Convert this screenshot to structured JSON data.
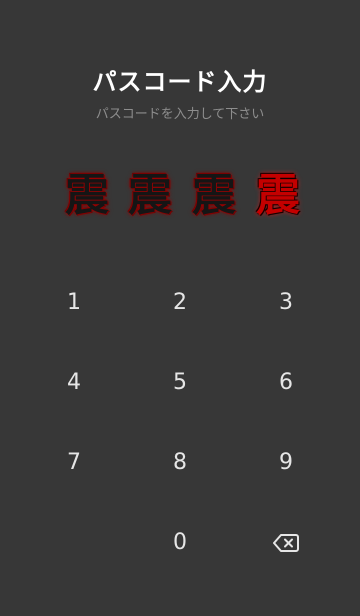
{
  "header": {
    "title": "パスコード入力",
    "subtitle": "パスコードを入力して下さい"
  },
  "indicators": {
    "glyph": "震",
    "entered_count": 1,
    "total": 4,
    "empty_color": "#151515",
    "filled_color": "#c40000",
    "glow_color": "#b30000"
  },
  "keypad": {
    "keys": [
      "1",
      "2",
      "3",
      "4",
      "5",
      "6",
      "7",
      "8",
      "9",
      "0"
    ],
    "backspace_icon": "backspace-icon"
  },
  "colors": {
    "background": "#373737",
    "title": "#ffffff",
    "subtitle": "#8d8d8d",
    "key_text": "#e6e6e6"
  }
}
